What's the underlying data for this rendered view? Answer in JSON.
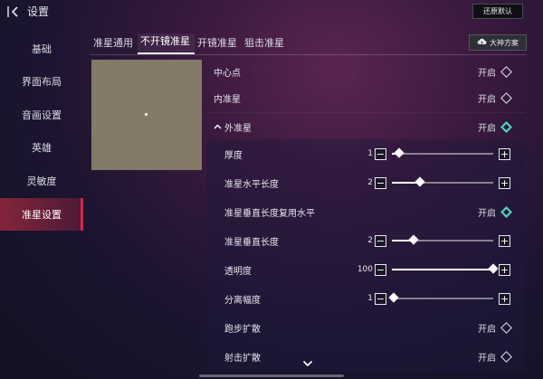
{
  "header": {
    "title": "设置",
    "restore_label": "还原默认"
  },
  "sidebar": {
    "items": [
      {
        "label": "基础",
        "active": false
      },
      {
        "label": "界面布局",
        "active": false
      },
      {
        "label": "音画设置",
        "active": false
      },
      {
        "label": "英雄",
        "active": false
      },
      {
        "label": "灵敏度",
        "active": false
      },
      {
        "label": "准星设置",
        "active": true
      }
    ]
  },
  "tabs": [
    {
      "label": "准星通用",
      "active": false
    },
    {
      "label": "不开镜准星",
      "active": true
    },
    {
      "label": "开镜准星",
      "active": false
    },
    {
      "label": "狙击准星",
      "active": false
    }
  ],
  "plan_button": {
    "label": "大神方案",
    "icon": "cloud-download-icon"
  },
  "settings": [
    {
      "label": "中心点",
      "type": "toggle",
      "state_label": "开启",
      "on": false
    },
    {
      "label": "内准星",
      "type": "toggle",
      "state_label": "开启",
      "on": false
    },
    {
      "label": "外准星",
      "type": "toggle",
      "state_label": "开启",
      "on": true,
      "expandable": true
    },
    {
      "label": "厚度",
      "type": "slider",
      "value": "1",
      "fraction": 0.07,
      "sub": true
    },
    {
      "label": "准星水平长度",
      "type": "slider",
      "value": "2",
      "fraction": 0.28,
      "sub": true
    },
    {
      "label": "准星垂直长度复用水平",
      "type": "toggle",
      "state_label": "开启",
      "on": true,
      "sub": true
    },
    {
      "label": "准星垂直长度",
      "type": "slider",
      "value": "2",
      "fraction": 0.21,
      "sub": true
    },
    {
      "label": "透明度",
      "type": "slider",
      "value": "100",
      "fraction": 1.0,
      "sub": true
    },
    {
      "label": "分离幅度",
      "type": "slider",
      "value": "1",
      "fraction": 0.02,
      "sub": true
    },
    {
      "label": "跑步扩散",
      "type": "toggle",
      "state_label": "开启",
      "on": false,
      "sub": true
    },
    {
      "label": "射击扩散",
      "type": "toggle",
      "state_label": "开启",
      "on": false,
      "sub": true
    }
  ],
  "colors": {
    "accent": "#d8244a",
    "toggle_on": "#57d2c3",
    "preview_bg": "#837a68"
  }
}
